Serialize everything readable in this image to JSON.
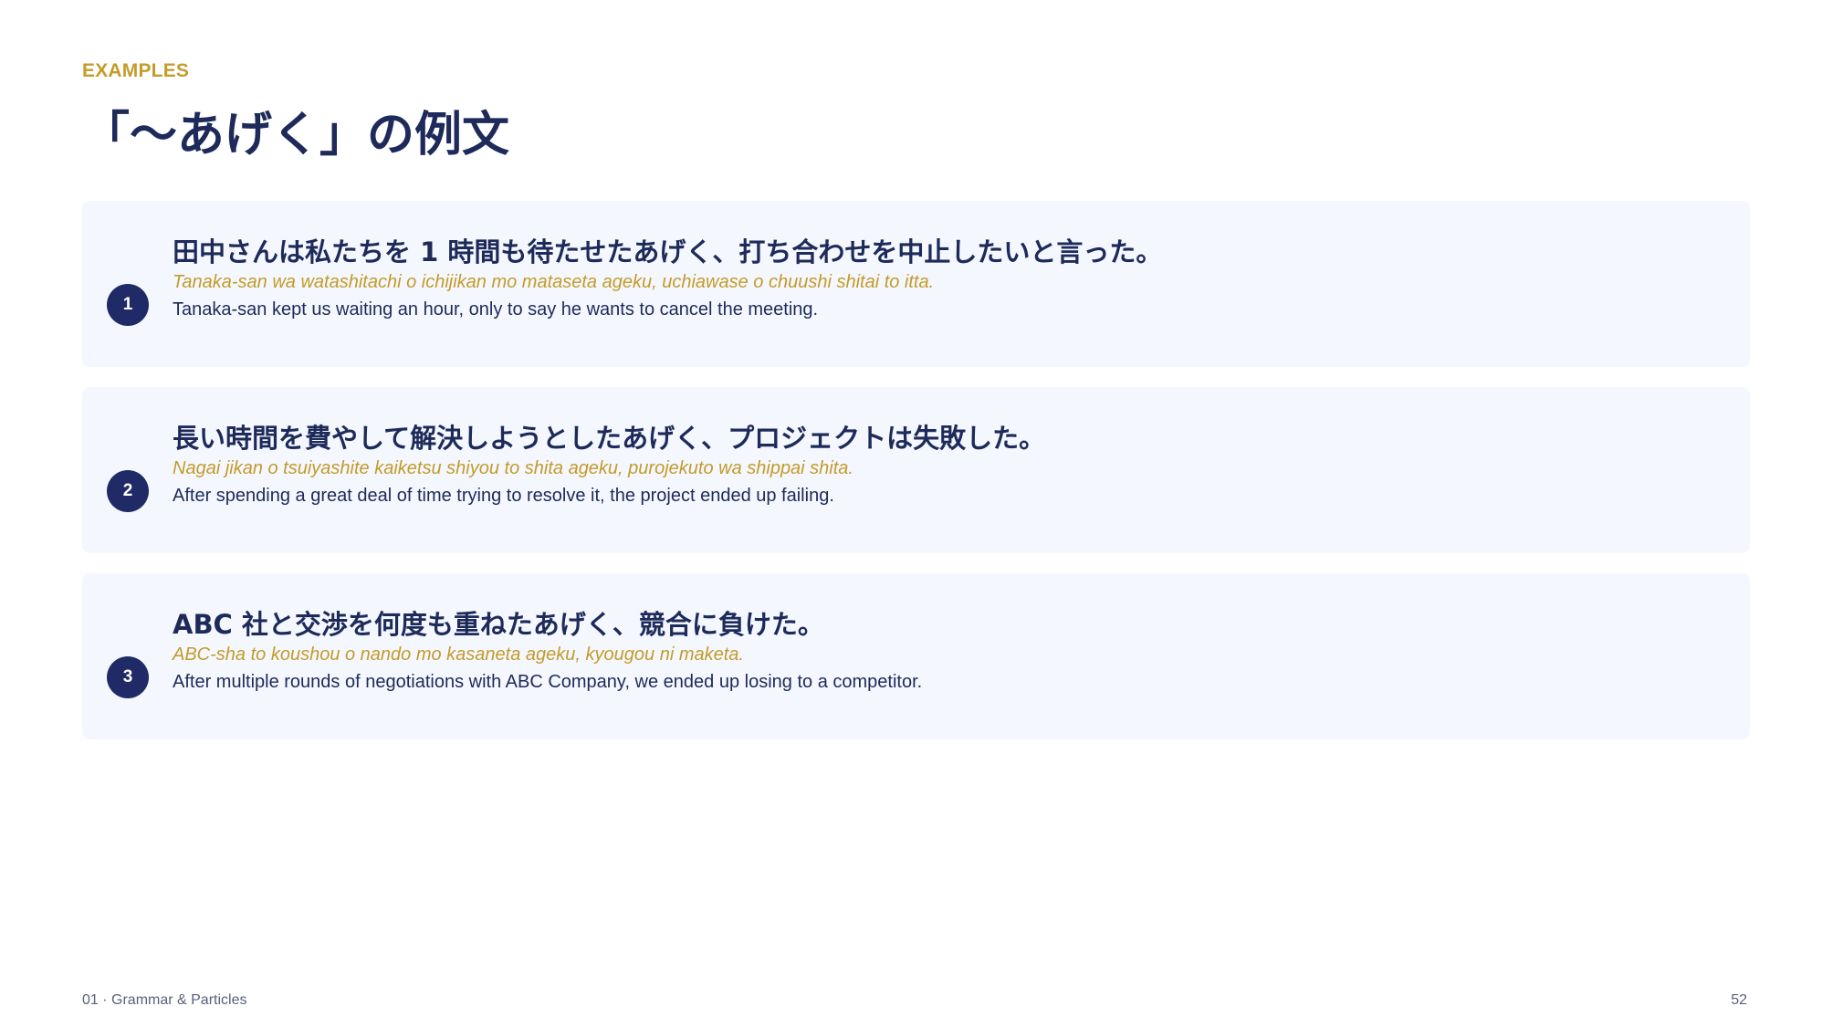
{
  "header": {
    "eyebrow": "EXAMPLES",
    "title": "「〜あげく」の例文"
  },
  "examples": [
    {
      "number": "1",
      "japanese": "田中さんは私たちを 1 時間も待たせたあげく、打ち合わせを中止したいと言った。",
      "romaji": "Tanaka-san wa watashitachi o ichijikan mo mataseta ageku, uchiawase o chuushi shitai to itta.",
      "english": "Tanaka-san kept us waiting an hour, only to say he wants to cancel the meeting."
    },
    {
      "number": "2",
      "japanese": "長い時間を費やして解決しようとしたあげく、プロジェクトは失敗した。",
      "romaji": "Nagai jikan o tsuiyashite kaiketsu shiyou to shita ageku, purojekuto wa shippai shita.",
      "english": "After spending a great deal of time trying to resolve it, the project ended up failing."
    },
    {
      "number": "3",
      "japanese": "ABC 社と交渉を何度も重ねたあげく、競合に負けた。",
      "romaji": "ABC-sha to koushou o nando mo kasaneta ageku, kyougou ni maketa.",
      "english": "After multiple rounds of negotiations with ABC Company, we ended up losing to a competitor."
    }
  ],
  "footer": {
    "section": "01 · Grammar & Particles",
    "page_number": "52"
  },
  "colors": {
    "accent_gold": "#c59b2a",
    "navy": "#1e2a5a",
    "card_bg": "#f4f8fe"
  }
}
